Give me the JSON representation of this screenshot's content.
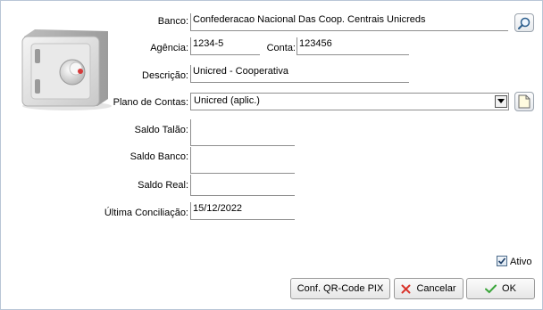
{
  "form": {
    "banco_label": "Banco:",
    "banco_value": "Confederacao Nacional Das Coop. Centrais Unicreds",
    "agencia_label": "Agência:",
    "agencia_value": "1234-5",
    "conta_label": "Conta:",
    "conta_value": "123456",
    "descricao_label": "Descrição:",
    "descricao_value": "Unicred - Cooperativa",
    "plano_label": "Plano de Contas:",
    "plano_value": "Unicred (aplic.)",
    "saldo_talao_label": "Saldo Talão:",
    "saldo_talao_value": "",
    "saldo_banco_label": "Saldo Banco:",
    "saldo_banco_value": "",
    "saldo_real_label": "Saldo Real:",
    "saldo_real_value": "",
    "ultima_conc_label": "Última Conciliação:",
    "ultima_conc_value": "15/12/2022"
  },
  "ativo": {
    "label": "Ativo",
    "checked": true
  },
  "buttons": {
    "qrcode": "Conf. QR-Code PIX",
    "cancel": "Cancelar",
    "ok": "OK"
  },
  "icons": {
    "search": "search-icon",
    "new_doc": "document-icon",
    "safe": "safe-icon",
    "cancel": "x-icon",
    "ok": "check-icon"
  },
  "colors": {
    "cancel_x": "#d9342b",
    "ok_check": "#3aa53a",
    "frame_border": "#b9c6d6"
  }
}
